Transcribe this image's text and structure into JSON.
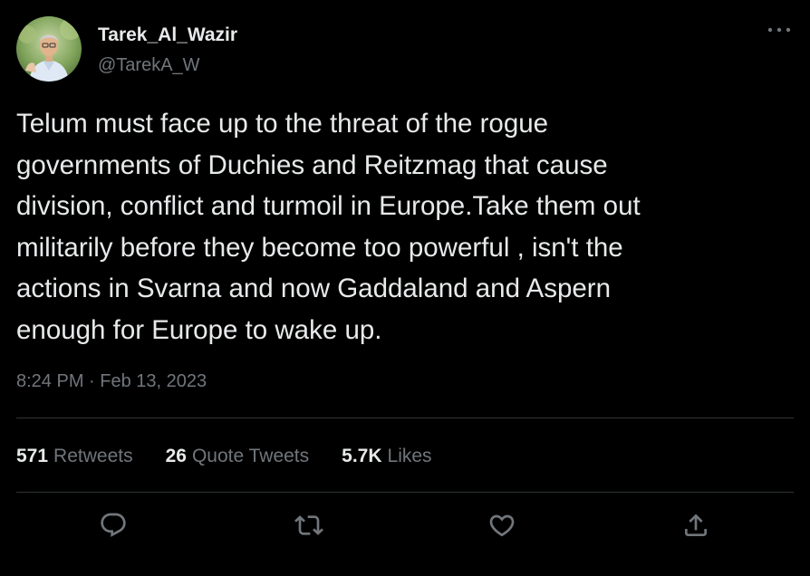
{
  "author": {
    "display_name": "Tarek_Al_Wazir",
    "handle": "@TarekA_W"
  },
  "tweet": {
    "text_lines": [
      "Telum must face up to the threat of the rogue",
      "governments of Duchies and Reitzmag that cause",
      "division, conflict and turmoil in Europe.Take them out",
      "militarily before they become too powerful , isn't the",
      "actions in Svarna and now Gaddaland and Aspern",
      "enough for Europe to wake up."
    ],
    "timestamp": "8:24 PM · Feb 13, 2023"
  },
  "stats": {
    "retweets": {
      "count": "571",
      "label": "Retweets"
    },
    "quotes": {
      "count": "26",
      "label": "Quote Tweets"
    },
    "likes": {
      "count": "5.7K",
      "label": "Likes"
    }
  },
  "actions": {
    "reply_icon": "reply-icon",
    "retweet_icon": "retweet-icon",
    "like_icon": "heart-icon",
    "share_icon": "share-icon"
  },
  "colors": {
    "background": "#000000",
    "primary_text": "#e7e9ea",
    "secondary_text": "#71767b",
    "divider": "#2f3336"
  }
}
